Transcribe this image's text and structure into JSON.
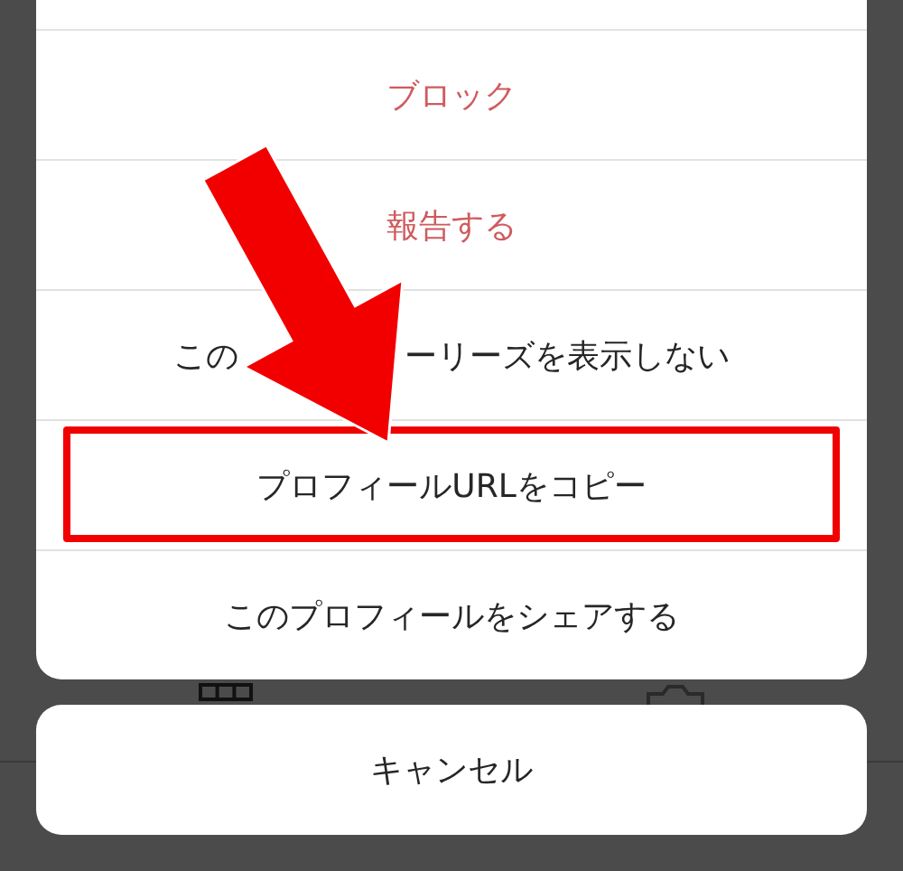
{
  "sheet": {
    "items": [
      {
        "kind": "destructive",
        "label": "ブロック",
        "highlighted": false
      },
      {
        "kind": "destructive",
        "label": "報告する",
        "highlighted": false
      },
      {
        "kind": "obscured",
        "visible_start": "この",
        "visible_end": "ーリーズを表示しない",
        "highlighted": false
      },
      {
        "kind": "normal",
        "label": "プロフィールURLをコピー",
        "highlighted": true
      },
      {
        "kind": "normal",
        "label": "このプロフィールをシェアする",
        "highlighted": false
      }
    ]
  },
  "cancel_button": "キャンセル"
}
